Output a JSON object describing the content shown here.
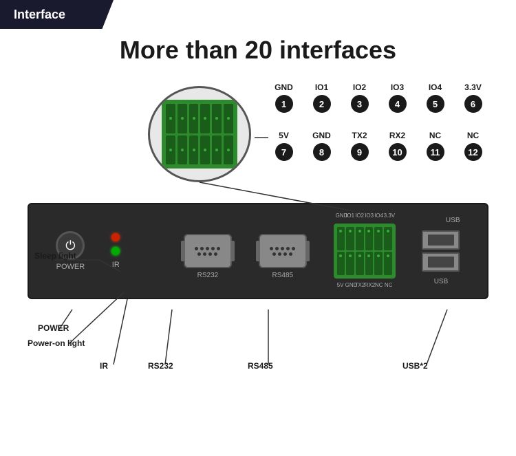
{
  "header": {
    "tab_label": "Interface"
  },
  "main": {
    "title": "More than 20 interfaces"
  },
  "connector_labels": {
    "row1": [
      {
        "name": "GND",
        "number": "1"
      },
      {
        "name": "IO1",
        "number": "2"
      },
      {
        "name": "IO2",
        "number": "3"
      },
      {
        "name": "IO3",
        "number": "4"
      },
      {
        "name": "IO4",
        "number": "5"
      },
      {
        "name": "3.3V",
        "number": "6"
      }
    ],
    "row2": [
      {
        "name": "5V",
        "number": "7"
      },
      {
        "name": "GND",
        "number": "8"
      },
      {
        "name": "TX2",
        "number": "9"
      },
      {
        "name": "RX2",
        "number": "10"
      },
      {
        "name": "NC",
        "number": "11"
      },
      {
        "name": "NC",
        "number": "12"
      }
    ]
  },
  "device": {
    "power_label": "POWER",
    "ir_label": "IR",
    "rs232_label": "RS232",
    "rs485_label": "RS485",
    "usb_label": "USB",
    "usb_count": "USB*2"
  },
  "annotations": {
    "sleep_light": "Sleep light",
    "power": "POWER",
    "power_on_light": "Power-on light",
    "ir": "IR",
    "rs232": "RS232",
    "rs485": "RS485",
    "usb": "USB*2"
  }
}
